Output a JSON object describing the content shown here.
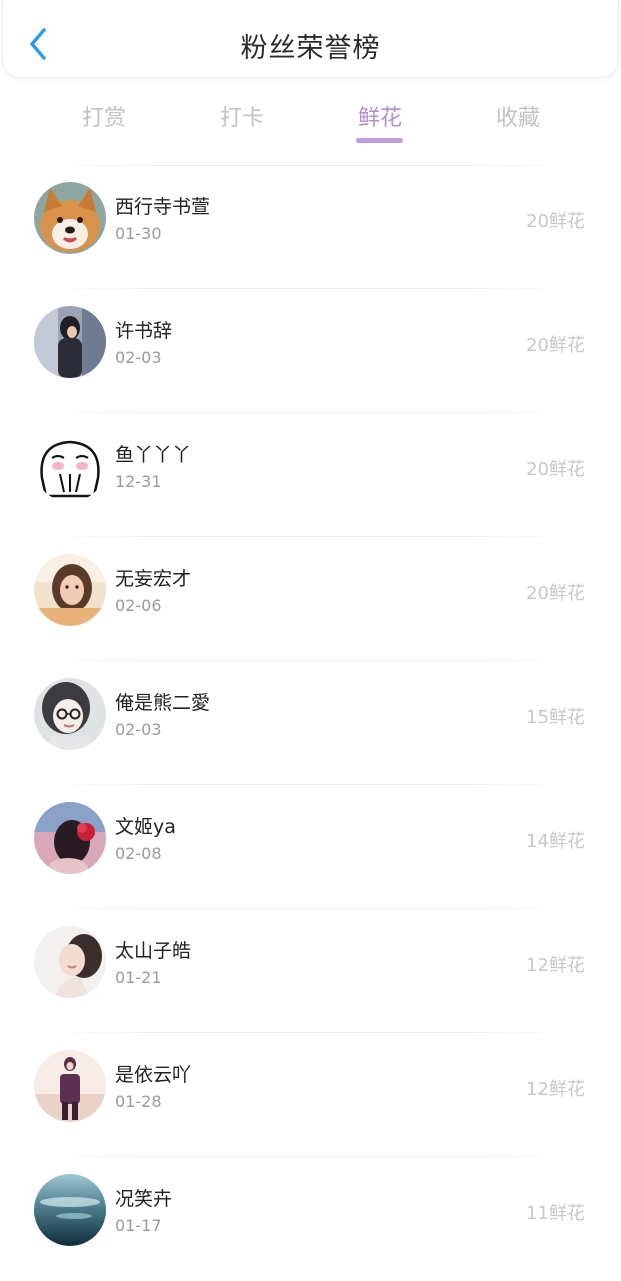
{
  "header": {
    "title": "粉丝荣誉榜",
    "back_icon": "chevron-left-icon",
    "accent_color": "#2f9bea"
  },
  "tabs": [
    {
      "label": "打赏",
      "active": false
    },
    {
      "label": "打卡",
      "active": false
    },
    {
      "label": "鲜花",
      "active": true
    },
    {
      "label": "收藏",
      "active": false
    }
  ],
  "active_tab_color": "#b58cd6",
  "fans": [
    {
      "name": "西行寺书萱",
      "date": "01-30",
      "amount": "20鲜花",
      "avatar": "shiba-dog-avatar"
    },
    {
      "name": "许书辞",
      "date": "02-03",
      "amount": "20鲜花",
      "avatar": "girl-photo-avatar"
    },
    {
      "name": "鱼丫丫丫",
      "date": "12-31",
      "amount": "20鲜花",
      "avatar": "doodle-face-avatar"
    },
    {
      "name": "无妄宏才",
      "date": "02-06",
      "amount": "20鲜花",
      "avatar": "woman-photo-avatar"
    },
    {
      "name": "俺是熊二愛",
      "date": "02-03",
      "amount": "15鲜花",
      "avatar": "glasses-girl-avatar"
    },
    {
      "name": "文姬ya",
      "date": "02-08",
      "amount": "14鲜花",
      "avatar": "red-flower-hair-avatar"
    },
    {
      "name": "太山子皓",
      "date": "01-21",
      "amount": "12鲜花",
      "avatar": "girl-profile-avatar"
    },
    {
      "name": "是依云吖",
      "date": "01-28",
      "amount": "12鲜花",
      "avatar": "standing-girl-avatar"
    },
    {
      "name": "况笑卉",
      "date": "01-17",
      "amount": "11鲜花",
      "avatar": "ocean-sky-avatar"
    }
  ]
}
